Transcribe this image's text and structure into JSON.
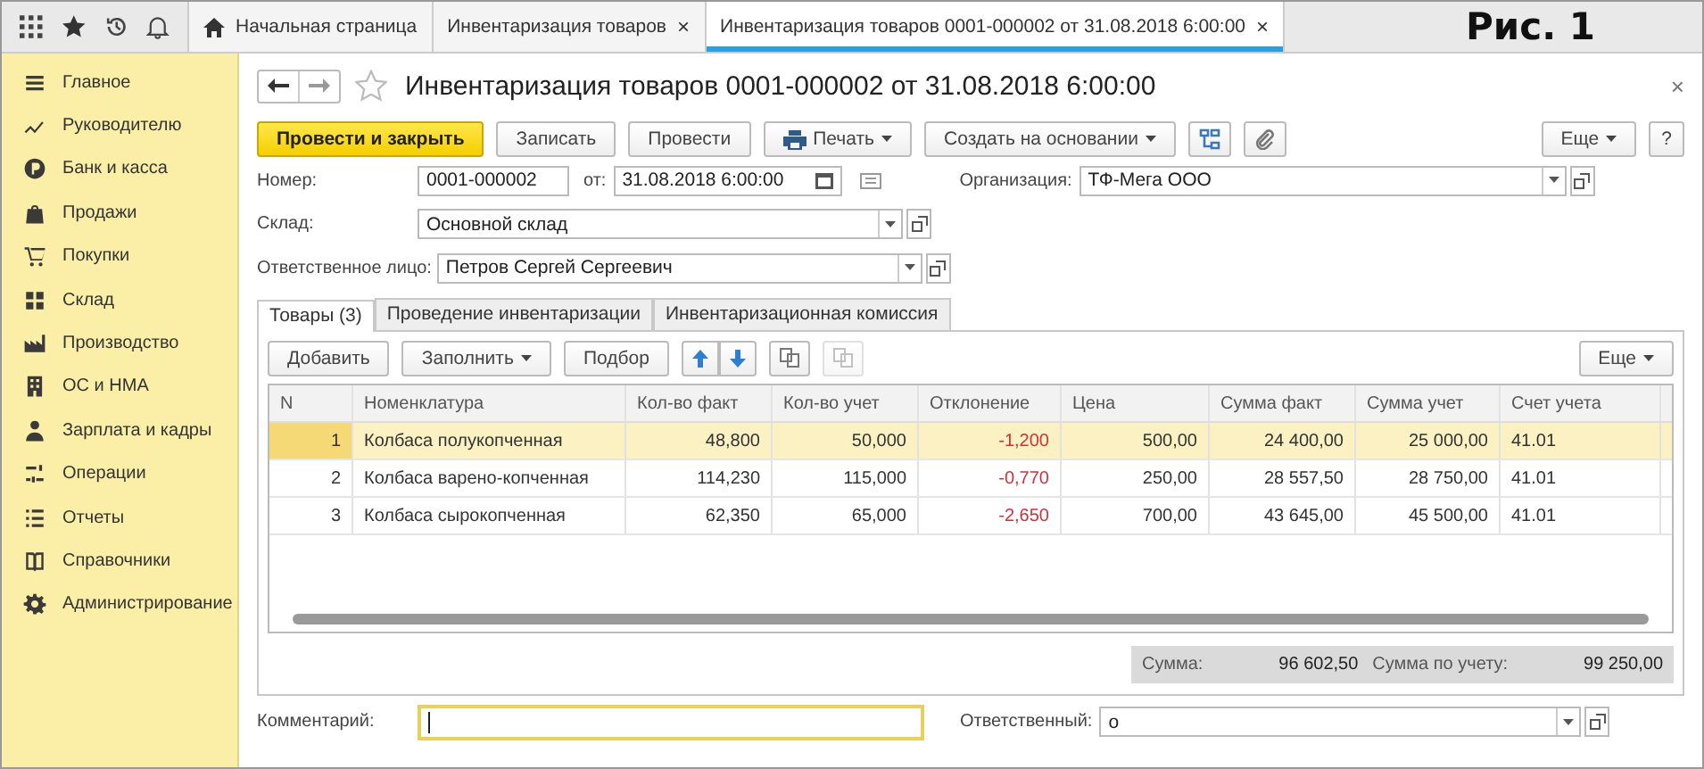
{
  "top_bar": {
    "tabs": [
      {
        "label": "Начальная страница",
        "kind": "home",
        "selected": false
      },
      {
        "label": "Инвентаризация товаров",
        "kind": "closable",
        "selected": false
      },
      {
        "label": "Инвентаризация товаров 0001-000002 от 31.08.2018 6:00:00",
        "kind": "closable",
        "selected": true
      }
    ],
    "close_glyph": "×",
    "figure_label": "Рис. 1"
  },
  "sidebar": {
    "items": [
      {
        "label": "Главное"
      },
      {
        "label": "Руководителю"
      },
      {
        "label": "Банк и касса"
      },
      {
        "label": "Продажи"
      },
      {
        "label": "Покупки"
      },
      {
        "label": "Склад"
      },
      {
        "label": "Производство"
      },
      {
        "label": "ОС и НМА"
      },
      {
        "label": "Зарплата и кадры"
      },
      {
        "label": "Операции"
      },
      {
        "label": "Отчеты"
      },
      {
        "label": "Справочники"
      },
      {
        "label": "Администрирование"
      }
    ]
  },
  "document": {
    "title": "Инвентаризация товаров 0001-000002 от 31.08.2018 6:00:00",
    "close_glyph": "×",
    "toolbar": [
      {
        "label": "Провести и закрыть",
        "kind": "primary"
      },
      {
        "label": "Записать",
        "kind": "plain"
      },
      {
        "label": "Провести",
        "kind": "plain"
      },
      {
        "label": "Печать",
        "kind": "print"
      },
      {
        "label": "Создать на основании",
        "kind": "dropdown"
      },
      {
        "kind": "structure"
      },
      {
        "kind": "attach"
      }
    ],
    "more_button": "Еще",
    "help_button": "?",
    "number": {
      "label": "Номер:",
      "value": "0001-000002"
    },
    "date": {
      "label": "от:",
      "value": "31.08.2018  6:00:00"
    },
    "organization": {
      "label": "Организация:",
      "value": "ТФ-Мега ООО"
    },
    "warehouse": {
      "label": "Склад:",
      "value": "Основной склад"
    },
    "responsible_person": {
      "label": "Ответственное лицо:",
      "value": "Петров Сергей Сергеевич"
    },
    "tabs": [
      {
        "label": "Товары (3)",
        "selected": true
      },
      {
        "label": "Проведение инвентаризации",
        "selected": false
      },
      {
        "label": "Инвентаризационная комиссия",
        "selected": false
      }
    ],
    "table_toolbar": [
      {
        "label": "Добавить",
        "kind": "plain"
      },
      {
        "label": "Заполнить",
        "kind": "dropdown"
      },
      {
        "label": "Подбор",
        "kind": "plain"
      },
      {
        "kind": "up"
      },
      {
        "kind": "down"
      },
      {
        "kind": "copy",
        "disabled": false
      },
      {
        "kind": "paste",
        "disabled": true
      }
    ],
    "table_more_button": "Еще",
    "table": {
      "columns": [
        {
          "label": "N",
          "kind": "number"
        },
        {
          "label": "Номенклатура",
          "kind": "text"
        },
        {
          "label": "Кол-во факт",
          "kind": "number"
        },
        {
          "label": "Кол-во учет",
          "kind": "number"
        },
        {
          "label": "Отклонение",
          "kind": "deviation"
        },
        {
          "label": "Цена",
          "kind": "number"
        },
        {
          "label": "Сумма факт",
          "kind": "number"
        },
        {
          "label": "Сумма учет",
          "kind": "number"
        },
        {
          "label": "Счет учета",
          "kind": "text"
        }
      ],
      "rows": [
        {
          "selected": true,
          "cells": [
            "1",
            "Колбаса полукопченная",
            "48,800",
            "50,000",
            "-1,200",
            "500,00",
            "24 400,00",
            "25 000,00",
            "41.01"
          ]
        },
        {
          "selected": false,
          "cells": [
            "2",
            "Колбаса варено-копченная",
            "114,230",
            "115,000",
            "-0,770",
            "250,00",
            "28 557,50",
            "28 750,00",
            "41.01"
          ]
        },
        {
          "selected": false,
          "cells": [
            "3",
            "Колбаса сырокопченная",
            "62,350",
            "65,000",
            "-2,650",
            "700,00",
            "43 645,00",
            "45 500,00",
            "41.01"
          ]
        }
      ]
    },
    "totals": [
      {
        "label": "Сумма:",
        "value": "96 602,50"
      },
      {
        "label": "Сумма по учету:",
        "value": "99 250,00"
      }
    ],
    "comment": {
      "label": "Комментарий:",
      "focused": true
    },
    "responsible": {
      "label": "Ответственный:",
      "value": "о"
    }
  }
}
